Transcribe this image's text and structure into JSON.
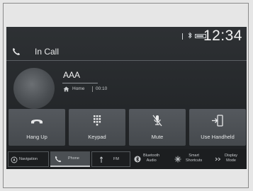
{
  "status_bar": {
    "clock": "12:34"
  },
  "header": {
    "title": "In Call"
  },
  "caller": {
    "name": "AAA",
    "number_type": "Home",
    "duration": "00:10"
  },
  "actions": [
    {
      "label": "Hang Up",
      "icon": "hang-up-icon"
    },
    {
      "label": "Keypad",
      "icon": "keypad-icon"
    },
    {
      "label": "Mute",
      "icon": "mute-icon"
    },
    {
      "label": "Use Handheld",
      "icon": "handheld-icon"
    }
  ],
  "bottom_tabs": [
    {
      "label": "Navigation",
      "icon": "navigation-icon"
    },
    {
      "label": "Phone",
      "icon": "phone-icon",
      "active": true
    },
    {
      "label": "FM",
      "icon": "audio-icon"
    },
    {
      "label": "Bluetooth Audio",
      "line1": "Bluetooth",
      "line2": "Audio",
      "icon": "bluetooth-icon"
    },
    {
      "label": "Smart Shortcuts",
      "line1": "Smart",
      "line2": "Shortcuts",
      "icon": "shortcuts-icon"
    },
    {
      "label": "Display Mode",
      "line1": "Display",
      "line2": "Mode",
      "icon": "display-mode-icon"
    }
  ],
  "colors": {
    "screen_bg": "#26292c",
    "button_bg": "#4e5257",
    "text": "#e5e7e8",
    "active_tab": "#4b4f53"
  }
}
